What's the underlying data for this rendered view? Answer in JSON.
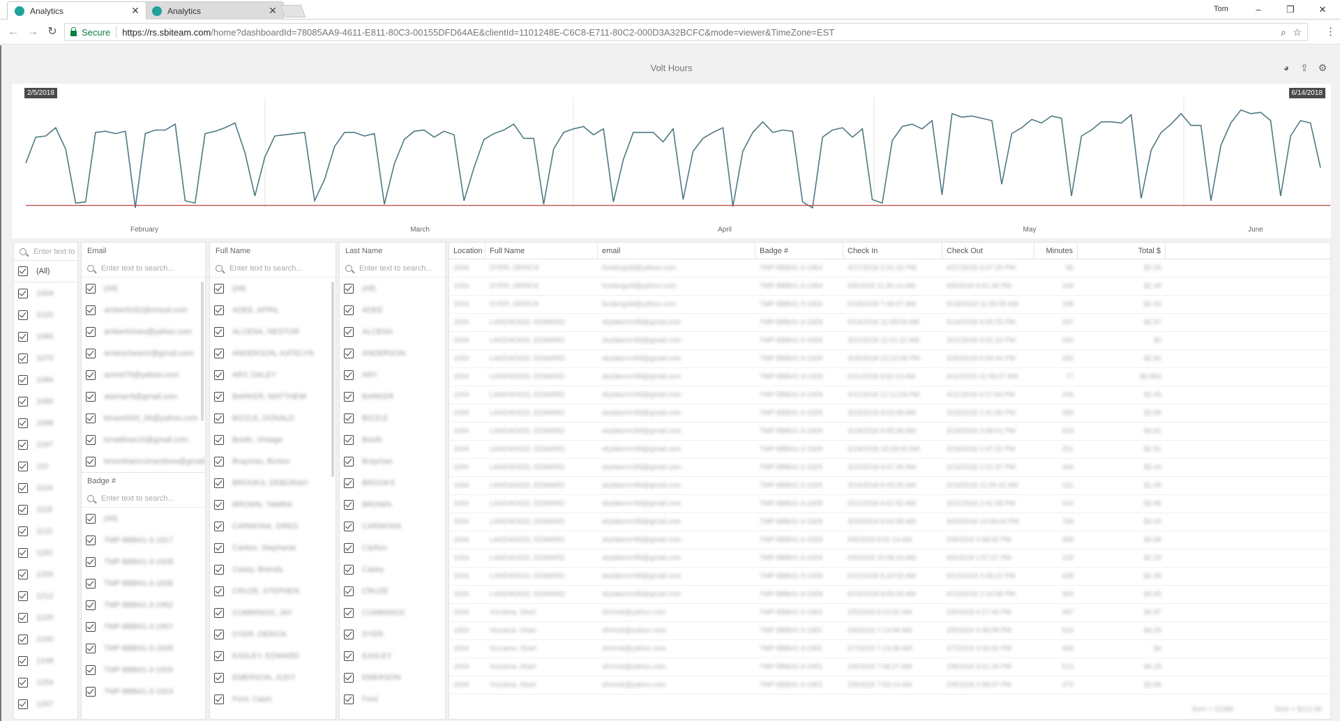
{
  "browser": {
    "tabs": [
      {
        "title": "Analytics",
        "close": "✕"
      },
      {
        "title": "Analytics",
        "close": "✕"
      }
    ],
    "profile": "Tom",
    "window_controls": {
      "minimize": "–",
      "maximize": "❐",
      "close": "✕"
    },
    "secure_label": "Secure",
    "url_host": "https://rs.sbiteam.com",
    "url_rest": "/home?dashboardId=78085AA9-4611-E811-80C3-00155DFD64AE&clientId=1101248E-C6C8-E711-80C2-000D3A32BCFC&mode=viewer&TimeZone=EST"
  },
  "dashboard": {
    "title": "Volt Hours"
  },
  "chart_data": {
    "type": "line",
    "start_label": "2/5/2018",
    "end_label": "6/14/2018",
    "x_ticks": [
      "February",
      "March",
      "April",
      "May",
      "June"
    ],
    "series": [
      {
        "color": "#4f7882",
        "values": [
          38,
          60,
          61,
          68,
          50,
          4,
          5,
          64,
          65,
          63,
          65,
          0,
          63,
          66,
          66,
          71,
          6,
          4,
          63,
          65,
          68,
          72,
          47,
          10,
          43,
          61,
          62,
          63,
          64,
          6,
          24,
          52,
          64,
          64,
          61,
          63,
          3,
          37,
          58,
          65,
          66,
          60,
          65,
          62,
          6,
          34,
          58,
          63,
          66,
          71,
          59,
          59,
          3,
          50,
          64,
          67,
          69,
          62,
          67,
          5,
          41,
          64,
          64,
          64,
          56,
          67,
          7,
          48,
          59,
          64,
          68,
          1,
          48,
          64,
          73,
          64,
          66,
          65,
          5,
          0,
          60,
          66,
          68,
          60,
          67,
          7,
          4,
          57,
          69,
          71,
          67,
          74,
          11,
          80,
          77,
          78,
          76,
          74,
          20,
          63,
          68,
          75,
          72,
          78,
          76,
          10,
          61,
          66,
          73,
          73,
          72,
          79,
          8,
          49,
          64,
          71,
          80,
          70,
          70,
          6,
          53,
          72,
          83,
          80,
          81,
          74,
          10,
          61,
          74,
          72,
          34
        ]
      },
      {
        "color": "#c05050",
        "values": [
          2,
          2,
          2,
          2,
          2,
          2,
          2,
          2,
          2,
          2,
          2,
          2,
          2,
          2,
          2,
          2,
          2,
          2,
          2,
          2,
          2,
          2,
          2,
          2,
          2,
          2,
          2,
          2,
          2,
          2,
          2,
          2,
          2,
          2,
          2,
          2,
          2,
          2,
          2,
          2,
          2,
          2,
          2,
          2,
          2,
          2,
          2,
          2,
          2,
          2,
          2,
          2,
          2,
          2,
          2,
          2,
          2,
          2,
          2,
          2,
          2,
          2,
          2,
          2,
          2,
          2,
          2,
          2,
          2,
          2,
          2,
          2,
          2,
          2,
          2,
          2,
          2,
          2,
          2,
          2,
          2,
          2,
          2,
          2,
          2,
          2,
          2,
          2,
          2,
          2,
          2,
          2,
          2,
          2,
          2,
          2,
          2,
          2,
          2,
          2,
          2,
          2,
          2,
          2,
          2,
          2,
          2,
          2,
          2,
          2,
          2,
          2,
          2,
          2,
          2,
          2,
          2,
          2,
          2,
          2,
          2,
          2,
          2,
          2,
          2,
          2,
          2,
          2,
          2,
          2,
          2,
          2
        ]
      }
    ],
    "ylim": [
      0,
      90
    ]
  },
  "filters": {
    "location": {
      "placeholder": "Enter text to search...",
      "all_label": "(All)",
      "items": [
        "1004",
        "1020",
        "1060",
        "1070",
        "1084",
        "1090",
        "1096",
        "1097",
        "110",
        "1104",
        "1118",
        "1122",
        "1182",
        "1200",
        "1212",
        "1220",
        "1240",
        "1248",
        "1254",
        "1267"
      ]
    },
    "email": {
      "title": "Email",
      "placeholder": "Enter text to search...",
      "items": [
        "(All)",
        "amber9182@icloud.com",
        "ambertrimes@yahoo.com",
        "amleschwartz@gmail.com",
        "amrist79@yahoo.com",
        "atamarr9@gmail.com",
        "bmax0000_89@yahoo.com",
        "bmatthias15@gmail.com",
        "bmonthamrumandrew@gmail.com"
      ]
    },
    "badge": {
      "title": "Badge #",
      "placeholder": "Enter text to search...",
      "items": [
        "(All)",
        "TMP-BBB41-3-1917",
        "TMP-BBB41-3-1928",
        "TMP-BBB41-3-1938",
        "TMP-BBB41-3-1952",
        "TMP-BBB41-3-1957",
        "TMP-BBB41-3-1928",
        "TMP-BBB41-3-1929",
        "TMP-BBB41-3-1919"
      ]
    },
    "full_name": {
      "title": "Full Name",
      "placeholder": "Enter text to search...",
      "items": [
        "(All)",
        "ADEE, APRIL",
        "ALCENA, NESTOR",
        "ANDERSON, KATELYN",
        "ARY, DALEY",
        "BARKER, MATTHEW",
        "BIZZLE, DONALD",
        "Booth, Vintage",
        "Brayman, Burton",
        "BROOKS, DEBORAH",
        "BROWN, TAMRA",
        "CARMONA, GREG",
        "Carlton, Stephanie",
        "Casey, Brenda",
        "CRUZE, STEPHEN",
        "CUMMINGS, JAY",
        "DYER, DERICK",
        "EASLEY, EDWARD",
        "EMERSON, JUDY",
        "Ford, Casin"
      ]
    },
    "last_name": {
      "title": "Last Name",
      "placeholder": "Enter text to search...",
      "items": [
        "(All)",
        "ADEE",
        "ALCENA",
        "ANDERSON",
        "ARY",
        "BARKER",
        "BIZZLE",
        "Booth",
        "Brayman",
        "BROOKS",
        "BROWN",
        "CARMONA",
        "Carlton",
        "Casey",
        "CRUZE",
        "CUMMINGS",
        "DYER",
        "EASLEY",
        "EMERSON",
        "Ford"
      ]
    }
  },
  "table": {
    "columns": [
      "Location",
      "Full Name",
      "email",
      "Badge #",
      "Check In",
      "Check Out",
      "Minutes",
      "Total $"
    ],
    "rows": [
      [
        "1004",
        "DYER, DERICK",
        "fondergold@yahoo.com",
        "TMP-BBB41-3-1954",
        "4/27/2018 2:01:32 PM",
        "4/27/2018 3:07:20 PM",
        "66",
        "$2.05"
      ],
      [
        "1004",
        "DYER, DERICK",
        "fondergold@yahoo.com",
        "TMP-BBB41-3-1954",
        "5/8/2018 11:30:14 AM",
        "5/8/2018 3:41:48 PM",
        "249",
        "$2.49"
      ],
      [
        "1004",
        "DYER, DERICK",
        "fondergold@yahoo.com",
        "TMP-BBB41-3-1954",
        "5/18/2018 7:46:07 AM",
        "5/18/2018 11:05:06 AM",
        "198",
        "$1.63"
      ],
      [
        "1004",
        "LAKEWOOD, EDWARD",
        "skylakerrrr99@gmail.com",
        "TMP-BBB41-3-1929",
        "5/14/2018 11:08:04 AM",
        "5/14/2018 4:05:25 PM",
        "297",
        "$2.97"
      ],
      [
        "1004",
        "LAKEWOOD, EDWARD",
        "skylakerrrr99@gmail.com",
        "TMP-BBB41-3-1929",
        "3/21/2018 11:01:22 AM",
        "3/21/2018 3:01:22 PM",
        "240",
        "$2"
      ],
      [
        "1004",
        "LAKEWOOD, EDWARD",
        "skylakerrrr99@gmail.com",
        "TMP-BBB41-3-1929",
        "3/20/2018 12:22:09 PM",
        "3/20/2018 5:04:44 PM",
        "282",
        "$2.82"
      ],
      [
        "1004",
        "LAKEWOOD, EDWARD",
        "skylakerrrr99@gmail.com",
        "TMP-BBB41-3-1929",
        "4/11/2018 8:52:13 AM",
        "4/11/2018 11:09:07 AM",
        "77",
        "$0.963"
      ],
      [
        "1004",
        "LAKEWOOD, EDWARD",
        "skylakerrrr99@gmail.com",
        "TMP-BBB41-3-1929",
        "4/11/2018 12:12:03 PM",
        "4/11/2018 4:17:03 PM",
        "245",
        "$2.45"
      ],
      [
        "1004",
        "LAKEWOOD, EDWARD",
        "skylakerrrr99@gmail.com",
        "TMP-BBB41-3-1929",
        "3/23/2018 8:03:08 AM",
        "3/23/2018 2:41:50 PM",
        "399",
        "$3.99"
      ],
      [
        "1004",
        "LAKEWOOD, EDWARD",
        "skylakerrrr99@gmail.com",
        "TMP-BBB41-3-1929",
        "3/19/2018 8:05:08 AM",
        "3/19/2018 3:08:01 PM",
        "423",
        "$3.61"
      ],
      [
        "1004",
        "LAKEWOOD, EDWARD",
        "skylakerrrr99@gmail.com",
        "TMP-BBB41-3-1929",
        "3/19/2018 10:28:02 AM",
        "3/19/2018 2:37:22 PM",
        "251",
        "$2.51"
      ],
      [
        "1004",
        "LAKEWOOD, EDWARD",
        "skylakerrrr99@gmail.com",
        "TMP-BBB41-3-1929",
        "3/16/2018 8:07:46 AM",
        "3/16/2018 2:01:37 PM",
        "344",
        "$3.44"
      ],
      [
        "1004",
        "LAKEWOOD, EDWARD",
        "skylakerrrr99@gmail.com",
        "TMP-BBB41-3-1929",
        "3/16/2018 8:43:26 AM",
        "3/16/2018 11:00:42 AM",
        "131",
        "$1.09"
      ],
      [
        "1004",
        "LAKEWOOD, EDWARD",
        "skylakerrrr99@gmail.com",
        "TMP-BBB41-3-1929",
        "3/21/2018 8:01:52 AM",
        "3/21/2018 2:41:58 PM",
        "410",
        "$3.95"
      ],
      [
        "1004",
        "LAKEWOOD, EDWARD",
        "skylakerrrr99@gmail.com",
        "TMP-BBB41-3-1929",
        "3/20/2018 8:02:08 AM",
        "3/20/2018 10:09:04 PM",
        "784",
        "$3.00"
      ],
      [
        "1004",
        "LAKEWOOD, EDWARD",
        "skylakerrrr99@gmail.com",
        "TMP-BBB41-3-1929",
        "5/9/2018 8:01:14 AM",
        "5/9/2018 2:08:02 PM",
        "368",
        "$3.68"
      ],
      [
        "1004",
        "LAKEWOOD, EDWARD",
        "skylakerrrr99@gmail.com",
        "TMP-BBB41-3-1929",
        "6/6/2018 10:08:24 AM",
        "6/6/2018 1:57:07 PM",
        "229",
        "$2.23"
      ],
      [
        "1004",
        "LAKEWOOD, EDWARD",
        "skylakerrrr99@gmail.com",
        "TMP-BBB41-3-1929",
        "6/12/2018 8:10:02 AM",
        "6/12/2018 3:28:22 PM",
        "438",
        "$2.48"
      ],
      [
        "1004",
        "LAKEWOOD, EDWARD",
        "skylakerrrr99@gmail.com",
        "TMP-BBB41-3-1929",
        "6/13/2018 8:05:06 AM",
        "6/13/2018 2:10:08 PM",
        "365",
        "$3.65"
      ],
      [
        "1004",
        "Vizcaina, Shari",
        "shrmnk@yahoo.com",
        "TMP-BBB41-3-1901",
        "2/5/2018 8:10:02 AM",
        "2/5/2018 4:27:46 PM",
        "497",
        "$4.97"
      ],
      [
        "1004",
        "Vizcaina, Shari",
        "shrmnk@yahoo.com",
        "TMP-BBB41-3-1901",
        "2/6/2018 7:14:08 AM",
        "2/6/2018 3:48:09 PM",
        "514",
        "$4.29"
      ],
      [
        "1004",
        "Vizcaina, Shari",
        "shrmnk@yahoo.com",
        "TMP-BBB41-3-1901",
        "2/7/2018 7:13:08 AM",
        "2/7/2018 3:16:02 PM",
        "483",
        "$4"
      ],
      [
        "1004",
        "Vizcaina, Shari",
        "shrmnk@yahoo.com",
        "TMP-BBB41-3-1901",
        "2/8/2018 7:08:27 AM",
        "2/8/2018 3:41:18 PM",
        "513",
        "$4.28"
      ],
      [
        "1004",
        "Vizcaina, Shari",
        "shrmnk@yahoo.com",
        "TMP-BBB41-3-1901",
        "2/9/2018 7:03:14 AM",
        "2/9/2018 2:58:07 PM",
        "475",
        "$3.96"
      ]
    ],
    "footer": {
      "minutes_sum": "Sum = 11288",
      "total_sum": "Sum = $112.46"
    }
  }
}
